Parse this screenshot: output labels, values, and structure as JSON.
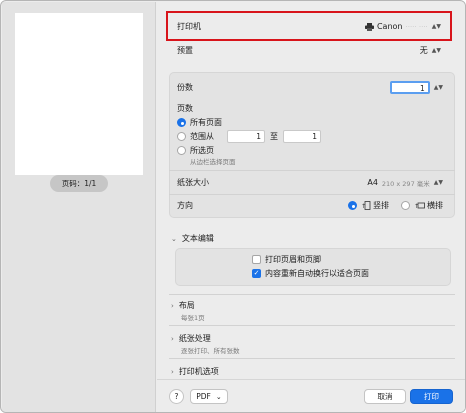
{
  "preview": {
    "page_indicator": "页码：1/1"
  },
  "printer": {
    "label": "打印机",
    "value": "Canon",
    "value_redacted": "·····  ····"
  },
  "preset": {
    "label": "预置",
    "value": "无"
  },
  "copies": {
    "label": "份数",
    "value": "1"
  },
  "pages": {
    "label": "页数",
    "all_pages": "所有页面",
    "range_from": "范围从",
    "range_start": "1",
    "range_to": "至",
    "range_end": "1",
    "selection": "所选页",
    "selection_hint": "从边栏选择页面"
  },
  "paper_size": {
    "label": "纸张大小",
    "value": "A4",
    "detail": "210 x 297 毫米"
  },
  "orientation": {
    "label": "方向",
    "portrait": "竖排",
    "landscape": "横排"
  },
  "text_editing": {
    "label": "文本编辑",
    "print_headers": "打印页眉和页脚",
    "rewrap": "内容重新自动换行以适合页面"
  },
  "layout": {
    "label": "布局",
    "summary": "每张1页"
  },
  "paper_handling": {
    "label": "纸张处理",
    "summary": "逐张打印、所有张数"
  },
  "printer_options": {
    "label": "打印机选项"
  },
  "footer": {
    "help": "?",
    "pdf": "PDF",
    "cancel": "取消",
    "print": "打印"
  },
  "colors": {
    "accent": "#1a72e8",
    "highlight_border": "#d8141b"
  }
}
